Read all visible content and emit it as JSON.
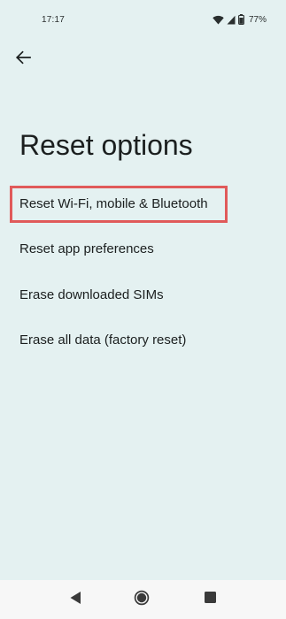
{
  "status_bar": {
    "time": "17:17",
    "battery_percent": "77%",
    "icons": [
      "wifi-icon",
      "signal-icon",
      "battery-icon"
    ]
  },
  "header": {
    "back_icon": "arrow-back-icon"
  },
  "page": {
    "title": "Reset options"
  },
  "options": [
    {
      "label": "Reset Wi-Fi, mobile & Bluetooth",
      "highlighted": true
    },
    {
      "label": "Reset app preferences",
      "highlighted": false
    },
    {
      "label": "Erase downloaded SIMs",
      "highlighted": false
    },
    {
      "label": "Erase all data (factory reset)",
      "highlighted": false
    }
  ],
  "nav_bar": {
    "buttons": [
      "back-triangle-icon",
      "home-circle-icon",
      "recents-square-icon"
    ]
  },
  "colors": {
    "background": "#e4f1f1",
    "highlight_border": "#e05a5a",
    "nav_background": "#f7f7f7"
  }
}
